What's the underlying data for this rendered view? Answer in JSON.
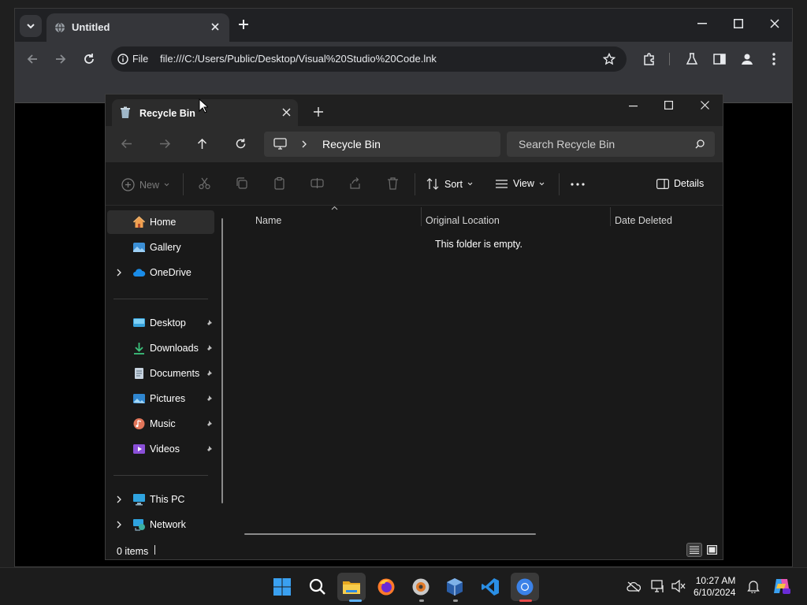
{
  "chrome": {
    "tab_title": "Untitled",
    "url_scheme": "File",
    "url": "file:///C:/Users/Public/Desktop/Visual%20Studio%20Code.lnk"
  },
  "explorer": {
    "tab_title": "Recycle Bin",
    "breadcrumb": "Recycle Bin",
    "search_placeholder": "Search Recycle Bin",
    "commands": {
      "new": "New",
      "sort": "Sort",
      "view": "View",
      "details": "Details"
    },
    "nav": {
      "home": "Home",
      "gallery": "Gallery",
      "onedrive": "OneDrive",
      "desktop": "Desktop",
      "downloads": "Downloads",
      "documents": "Documents",
      "pictures": "Pictures",
      "music": "Music",
      "videos": "Videos",
      "this_pc": "This PC",
      "network": "Network"
    },
    "columns": {
      "name": "Name",
      "original_location": "Original Location",
      "date_deleted": "Date Deleted"
    },
    "empty_message": "This folder is empty.",
    "status": "0 items"
  },
  "taskbar": {
    "time": "10:27 AM",
    "date": "6/10/2024",
    "icons": [
      "windows-start-icon",
      "search-icon",
      "file-explorer-icon",
      "firefox-icon",
      "media-player-icon",
      "virtualbox-icon",
      "vscode-icon",
      "chrome-icon"
    ]
  },
  "colors": {
    "accent_blue": "#0078d4",
    "folder_yellow": "#f5c242",
    "chrome_dark": "#202124"
  }
}
